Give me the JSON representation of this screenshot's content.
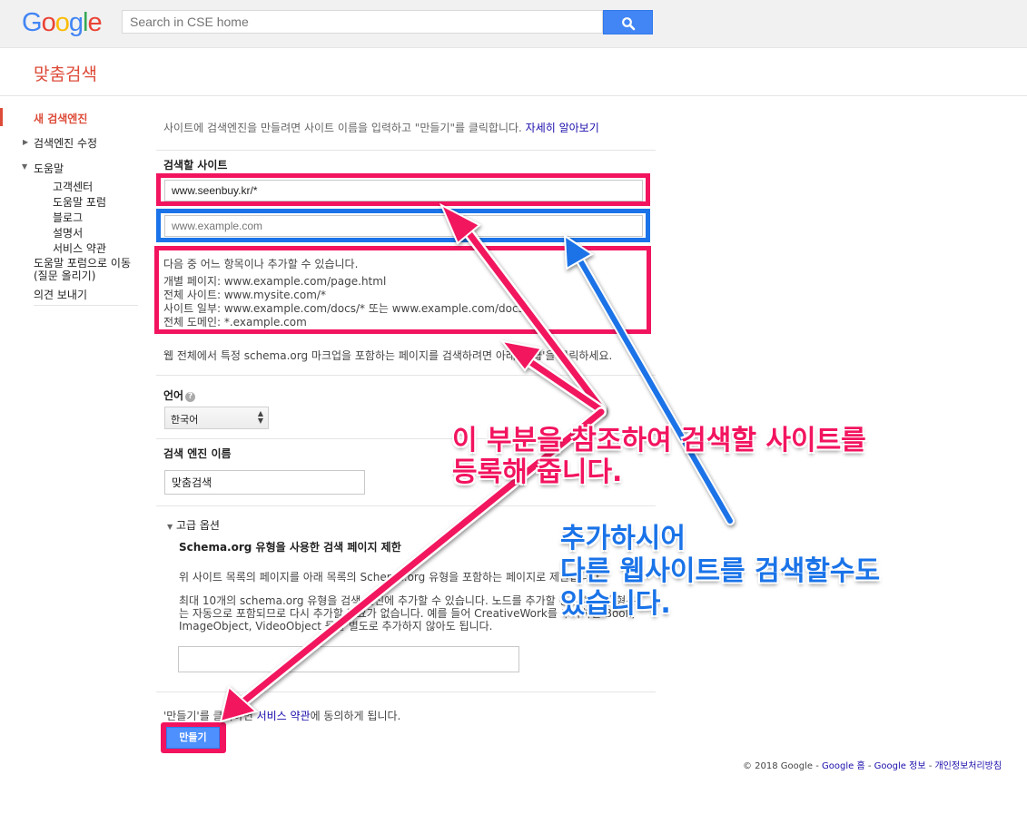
{
  "header": {
    "logo_letters": [
      {
        "ch": "G",
        "color": "#4285f4"
      },
      {
        "ch": "o",
        "color": "#ea4335"
      },
      {
        "ch": "o",
        "color": "#fbbc05"
      },
      {
        "ch": "g",
        "color": "#4285f4"
      },
      {
        "ch": "l",
        "color": "#34a853"
      },
      {
        "ch": "e",
        "color": "#ea4335"
      }
    ],
    "search_placeholder": "Search in CSE home",
    "search_icon": "magnifier-icon"
  },
  "app_title": "맞춤검색",
  "sidebar": {
    "new_engine": "새 검색엔진",
    "edit_engine": "검색엔진 수정",
    "help": "도움말",
    "help_items": [
      "고객센터",
      "도움말 포럼",
      "블로그",
      "설명서",
      "서비스 약관"
    ],
    "forum_line1": "도움말 포럼으로 이동",
    "forum_line2": "(질문 올리기)",
    "feedback": "의견 보내기"
  },
  "form": {
    "intro": "사이트에 검색엔진을 만들려면 사이트 이름을 입력하고 \"만들기\"를 클릭합니다.",
    "intro_link": "자세히 알아보기",
    "sites_label": "검색할 사이트",
    "site_value": "www.seenbuy.kr/*",
    "site_placeholder": "www.example.com",
    "help_title": "다음 중 어느 항목이나 추가할 수 있습니다.",
    "help_lines": [
      "개별 페이지: www.example.com/page.html",
      "전체 사이트: www.mysite.com/*",
      "사이트 일부: www.example.com/docs/* 또는 www.example.com/docs/",
      "전체 도메인: *.example.com"
    ],
    "schema_note": "웹 전체에서 특정 schema.org 마크업을 포함하는 페이지를 검색하려면 아래 '고급'을 클릭하세요.",
    "language_label": "언어",
    "language_value": "한국어",
    "name_label": "검색 엔진 이름",
    "name_value": "맞춤검색",
    "advanced_label": "고급 옵션",
    "advanced_title": "Schema.org 유형을 사용한 검색 페이지 제한",
    "advanced_p1": "위 사이트 목록의 페이지를 아래 목록의 Schema.org 유형을 포함하는 페이지로 제한합니다.",
    "advanced_p2_l1": "최대 10개의 schema.org 유형을 검색 엔진에 추가할 수 있습니다. 노드를 추가할 경우 하위 유형은",
    "advanced_p2_l2": "는 자동으로 포함되므로 다시 추가할 필요가 없습니다. 예를 들어 CreativeWork를 추가하면 Book,",
    "advanced_p2_l3": "ImageObject, VideoObject 등을 별도로 추가하지 않아도 됩니다.",
    "terms_prefix": "'만들기'를 클릭하면 ",
    "terms_link": "서비스 약관",
    "terms_suffix": "에 동의하게 됩니다.",
    "create_button": "만들기"
  },
  "footer": {
    "copyright": "© 2018 Google",
    "sep": " - ",
    "links": [
      "Google 홈",
      "Google 정보",
      "개인정보처리방침"
    ]
  },
  "annotations": {
    "pink_line1": "이 부분을 참조하여 검색할 사이트를",
    "pink_line2": "등록해 줍니다.",
    "blue_line1": "추가하시어",
    "blue_line2": "다른 웹사이트를 검색할수도",
    "blue_line3": "있습니다.",
    "pink_color": "#f2145f",
    "blue_color": "#1a73e8"
  }
}
